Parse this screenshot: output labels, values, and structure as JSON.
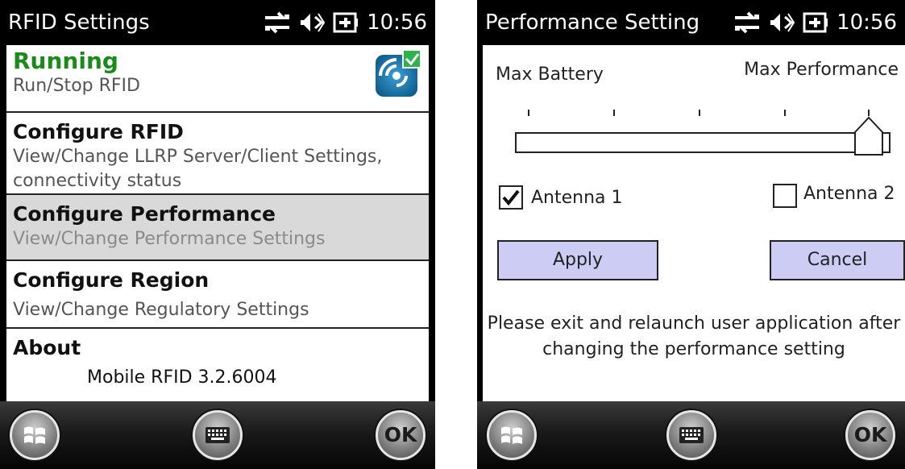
{
  "left": {
    "status_title": "RFID Settings",
    "clock": "10:56",
    "items": [
      {
        "title": "Running",
        "subtitle": "Run/Stop RFID"
      },
      {
        "title": "Configure RFID",
        "subtitle_line1": "View/Change LLRP Server/Client Settings,",
        "subtitle_line2": "connectivity status"
      },
      {
        "title": "Configure Performance",
        "subtitle": "View/Change Performance Settings"
      },
      {
        "title": "Configure Region",
        "subtitle": "View/Change Regulatory Settings"
      },
      {
        "title": "About",
        "version": "Mobile RFID 3.2.6004"
      }
    ]
  },
  "right": {
    "status_title": "Performance Setting",
    "clock": "10:56",
    "max_battery": "Max Battery",
    "max_performance": "Max Performance",
    "slider_level_fraction": 1.0,
    "antenna1": {
      "label": "Antenna 1",
      "checked": true
    },
    "antenna2": {
      "label": "Antenna 2",
      "checked": false
    },
    "apply": "Apply",
    "cancel": "Cancel",
    "message_line1": "Please exit and relaunch user application after",
    "message_line2": "changing the performance setting"
  },
  "taskbar": {
    "ok_label": "OK"
  },
  "colors": {
    "running_green": "#1a8a1a",
    "selected_row": "#d9d9d9",
    "button_fill": "#ccccf5"
  }
}
